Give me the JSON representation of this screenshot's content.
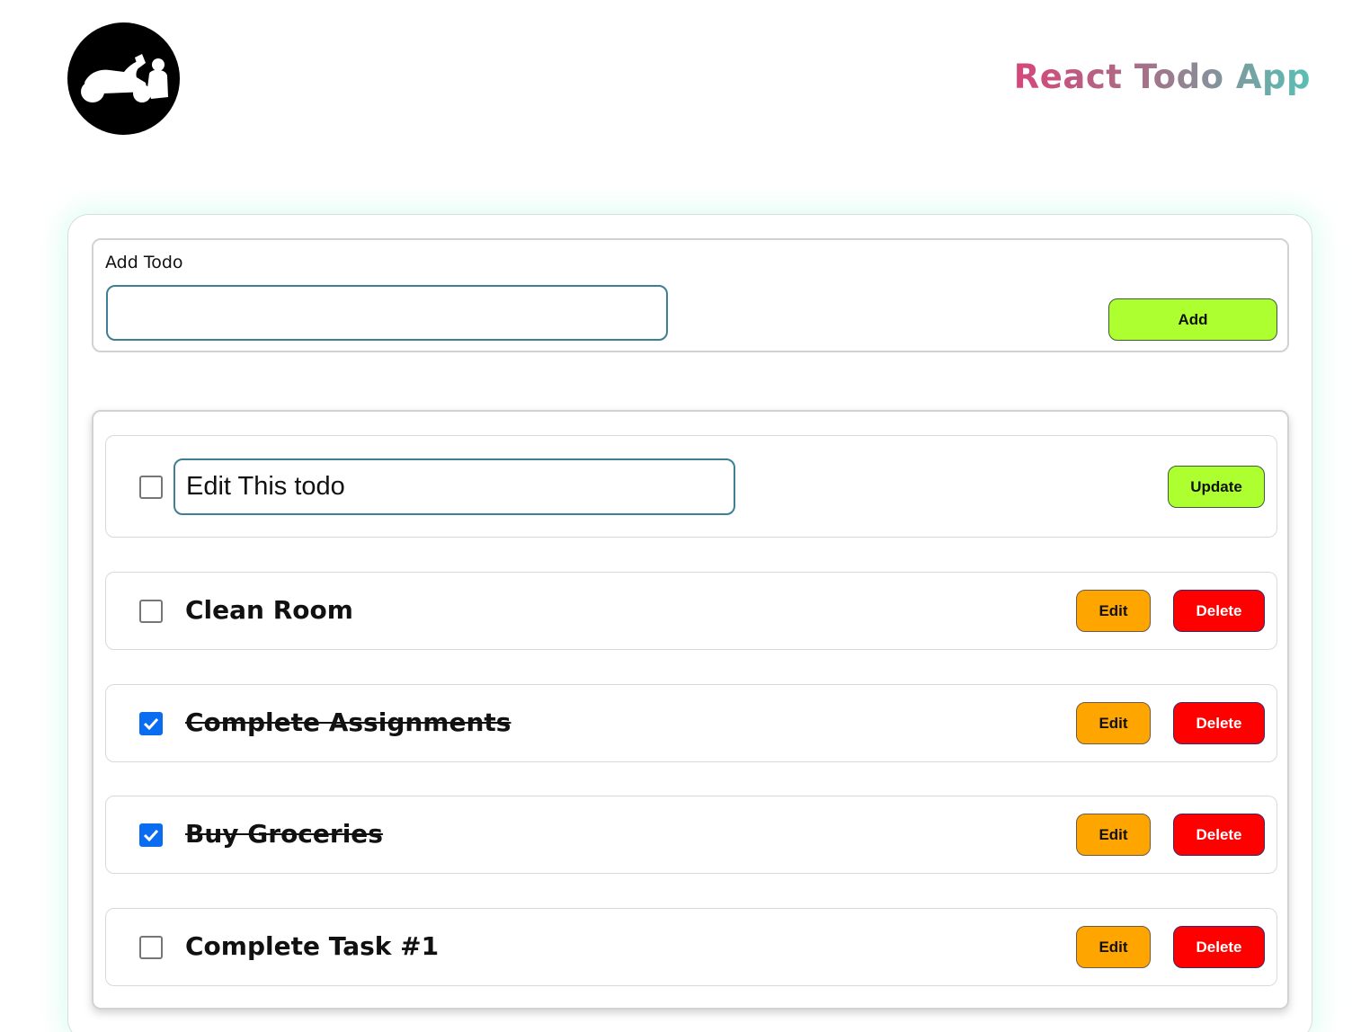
{
  "header": {
    "title": "React Todo App",
    "logo_icon": "motorcycle-rider-icon"
  },
  "add_section": {
    "label": "Add Todo",
    "input_value": "",
    "add_label": "Add"
  },
  "editing_todo": {
    "value": "Edit This todo",
    "completed": false,
    "update_label": "Update"
  },
  "todos": [
    {
      "text": "Clean Room",
      "completed": false,
      "edit_label": "Edit",
      "delete_label": "Delete"
    },
    {
      "text": "Complete Assignments",
      "completed": true,
      "edit_label": "Edit",
      "delete_label": "Delete"
    },
    {
      "text": "Buy Groceries",
      "completed": true,
      "edit_label": "Edit",
      "delete_label": "Delete"
    },
    {
      "text": "Complete Task #1",
      "completed": false,
      "edit_label": "Edit",
      "delete_label": "Delete"
    }
  ],
  "colors": {
    "add_button": "#adff2f",
    "edit_button": "#ffa500",
    "delete_button": "#ff0000",
    "checkbox_checked": "#0a6cf0",
    "title_gradient_start": "#d6467a",
    "title_gradient_end": "#58c0b4"
  }
}
